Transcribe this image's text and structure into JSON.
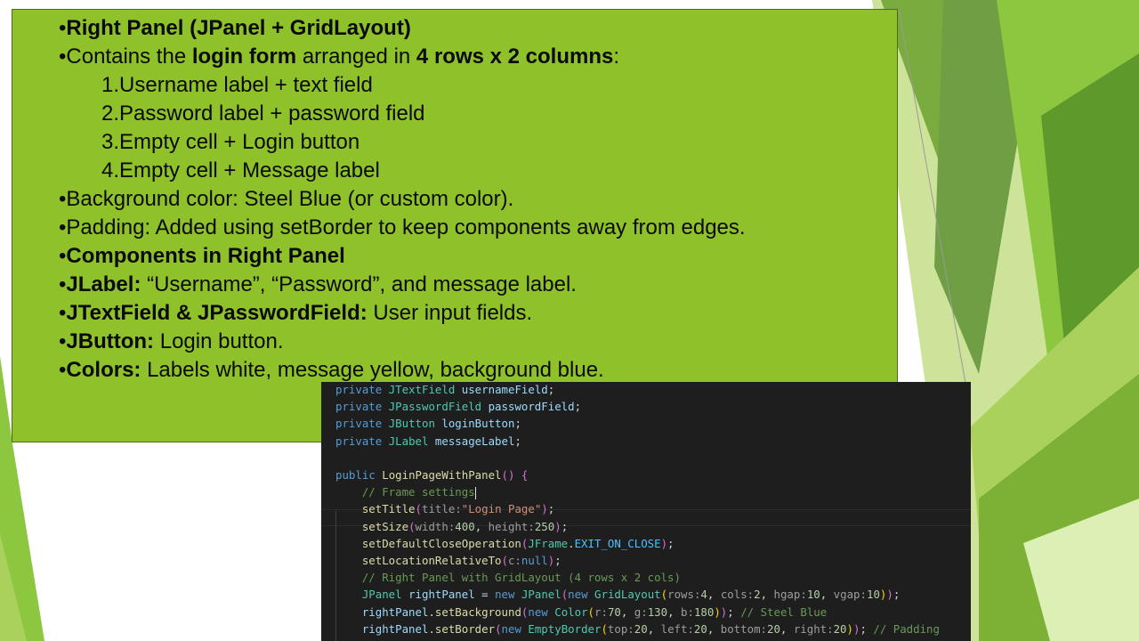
{
  "slide": {
    "lines": [
      {
        "bullet": "•",
        "bold": "Right Panel (JPanel + GridLayout)"
      },
      {
        "bullet": "•",
        "parts": [
          {
            "text": "Contains the ",
            "b": false
          },
          {
            "text": "login form",
            "b": true
          },
          {
            "text": " arranged in ",
            "b": false
          },
          {
            "text": "4 rows x 2 columns",
            "b": true
          },
          {
            "text": ":",
            "b": false
          }
        ]
      },
      {
        "text": "1.Username label + text field"
      },
      {
        "text": "2.Password label + password field"
      },
      {
        "text": "3.Empty cell + Login button"
      },
      {
        "text": "4.Empty cell + Message label"
      },
      {
        "bullet": "•",
        "text": "Background color: Steel Blue (or custom color)."
      },
      {
        "bullet": "•",
        "text": "Padding: Added using setBorder to keep components away from edges."
      },
      {
        "bullet": "•",
        "bold": "Components in Right Panel"
      },
      {
        "bullet": "•",
        "bold": "JLabel:",
        "text": " “Username”, “Password”, and message label."
      },
      {
        "bullet": "•",
        "bold": "JTextField & JPasswordField:",
        "text": " User input fields."
      },
      {
        "bullet": "•",
        "bold": "JButton:",
        "text": " Login button."
      },
      {
        "bullet": "•",
        "bold": "Colors:",
        "text": " Labels white, message yellow, background blue."
      }
    ]
  },
  "code": {
    "lines": [
      "private JTextField usernameField;",
      "private JPasswordField passwordField;",
      "private JButton loginButton;",
      "private JLabel messageLabel;",
      "",
      "public LoginPageWithPanel() {",
      "    // Frame settings",
      "    setTitle(title:\"Login Page\");",
      "    setSize(width:400, height:250);",
      "    setDefaultCloseOperation(JFrame.EXIT_ON_CLOSE);",
      "    setLocationRelativeTo(c:null);",
      "    // Right Panel with GridLayout (4 rows x 2 cols)",
      "    JPanel rightPanel = new JPanel(new GridLayout(rows:4, cols:2, hgap:10, vgap:10));",
      "    rightPanel.setBackground(new Color(r:70, g:130, b:180)); // Steel Blue",
      "    rightPanel.setBorder(new EmptyBorder(top:20, left:20, bottom:20, right:20)); // Padding"
    ]
  },
  "theme": {
    "slide_green": "#8fc12a",
    "code_bg": "#1e1e1e"
  }
}
